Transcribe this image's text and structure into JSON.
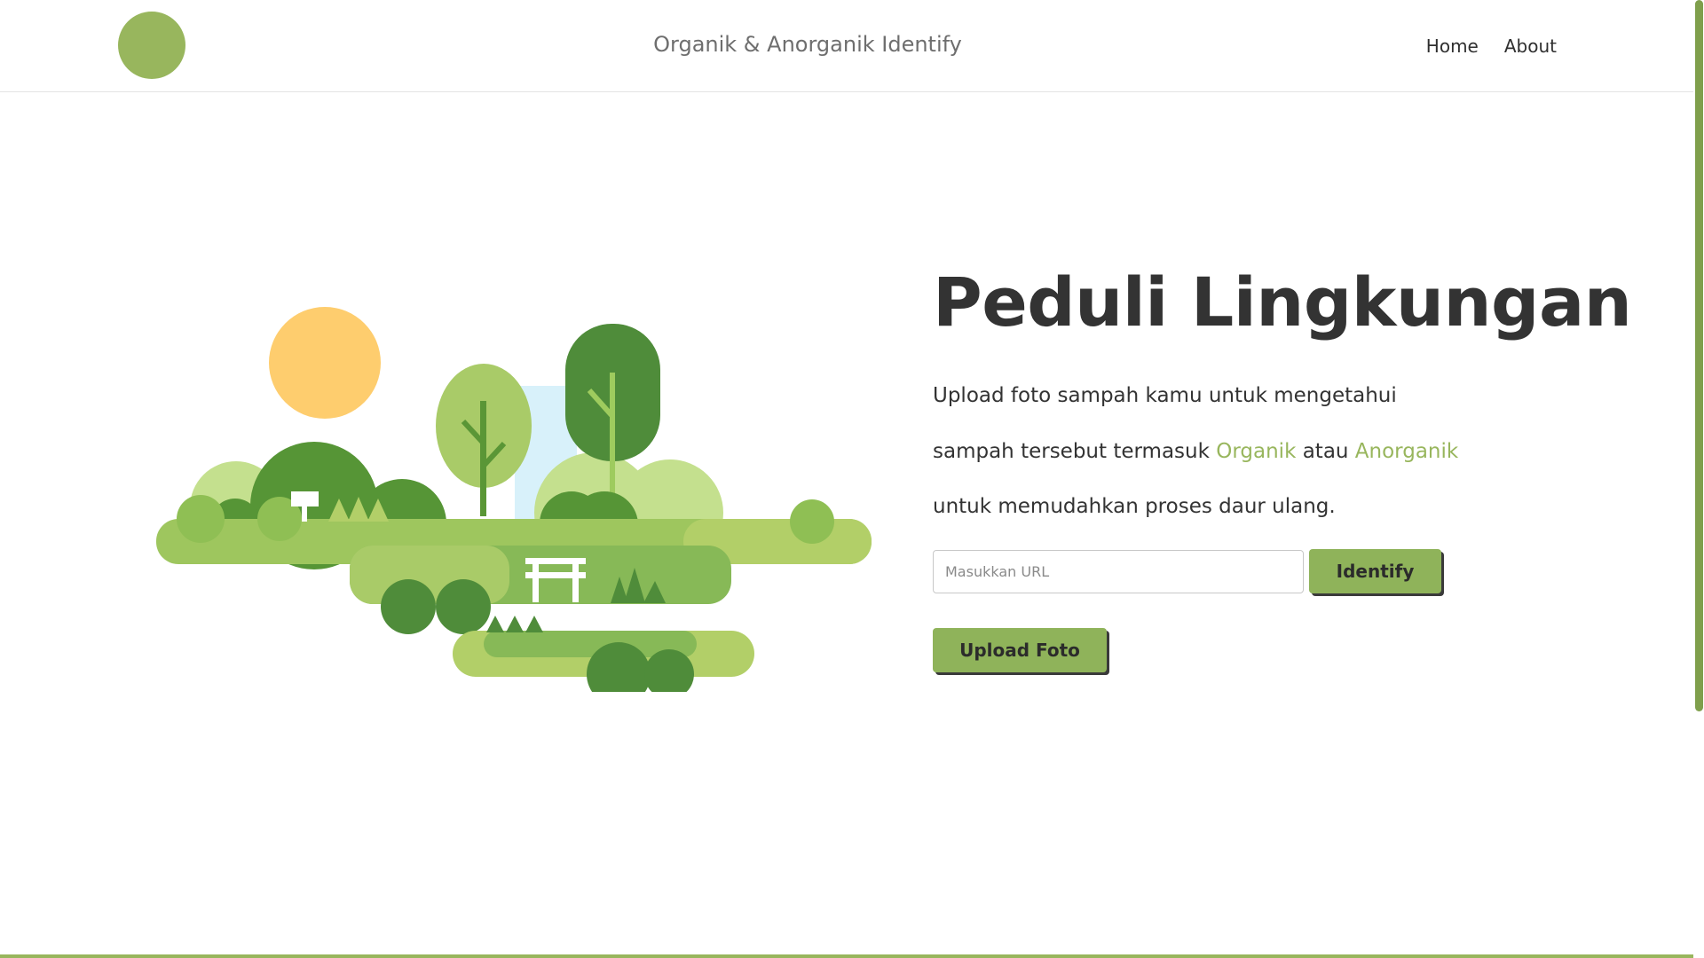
{
  "header": {
    "site_title": "Organik & Anorganik Identify",
    "nav": [
      {
        "label": "Home"
      },
      {
        "label": "About"
      }
    ]
  },
  "hero": {
    "title": "Peduli Lingkungan",
    "description": {
      "line1": "Upload foto sampah kamu untuk mengetahui",
      "line2_pre": "sampah tersebut termasuk ",
      "organik": "Organik",
      "line2_mid": " atau ",
      "anorganik": "Anorganik",
      "line3": "untuk memudahkan proses daur ulang."
    },
    "url_input": {
      "placeholder": "Masukkan URL",
      "value": ""
    },
    "identify_label": "Identify",
    "upload_label": "Upload Foto"
  },
  "colors": {
    "accent": "#98b65d",
    "button": "#8fb35a",
    "text": "#333333"
  },
  "icons": {
    "logo": "logo-circle",
    "illustration": "park-landscape-illustration"
  }
}
